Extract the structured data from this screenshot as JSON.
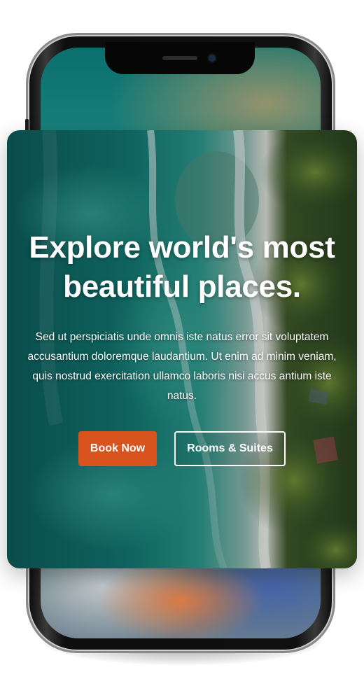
{
  "hero": {
    "title": "Explore world's most beautiful places.",
    "description": "Sed ut perspiciatis unde omnis iste natus error sit voluptatem accusantium doloremque laudantium. Ut enim ad minim veniam, quis nostrud exercitation ullamco laboris nisi accus antium iste natus.",
    "primary_button": "Book Now",
    "secondary_button": "Rooms & Suites"
  },
  "colors": {
    "accent": "#d9531e",
    "text": "#ffffff",
    "ocean": "#0f6f6b",
    "forest": "#2f4a1f"
  }
}
